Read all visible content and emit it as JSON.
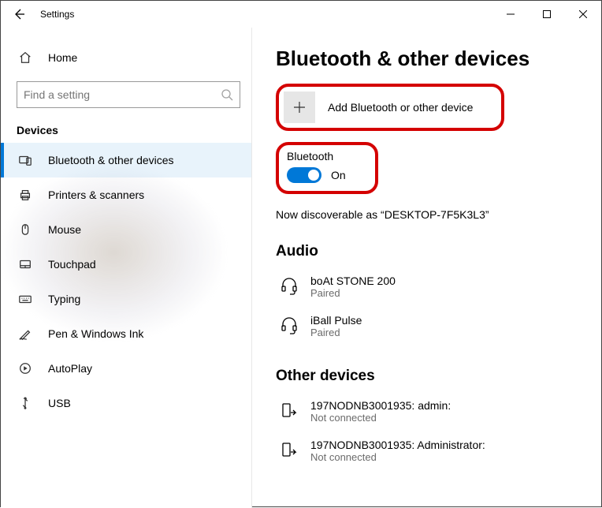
{
  "window": {
    "title": "Settings"
  },
  "sidebar": {
    "home": "Home",
    "search_placeholder": "Find a setting",
    "section": "Devices",
    "items": [
      {
        "label": "Bluetooth & other devices"
      },
      {
        "label": "Printers & scanners"
      },
      {
        "label": "Mouse"
      },
      {
        "label": "Touchpad"
      },
      {
        "label": "Typing"
      },
      {
        "label": "Pen & Windows Ink"
      },
      {
        "label": "AutoPlay"
      },
      {
        "label": "USB"
      }
    ]
  },
  "main": {
    "title": "Bluetooth & other devices",
    "add_device": "Add Bluetooth or other device",
    "bluetooth_heading": "Bluetooth",
    "toggle_state": "On",
    "discoverable": "Now discoverable as “DESKTOP-7F5K3L3”",
    "audio_heading": "Audio",
    "audio": [
      {
        "name": "boAt STONE 200",
        "status": "Paired"
      },
      {
        "name": "iBall Pulse",
        "status": "Paired"
      }
    ],
    "other_heading": "Other devices",
    "other": [
      {
        "name": "197NODNB3001935: admin:",
        "status": "Not connected"
      },
      {
        "name": "197NODNB3001935: Administrator:",
        "status": "Not connected"
      }
    ]
  }
}
